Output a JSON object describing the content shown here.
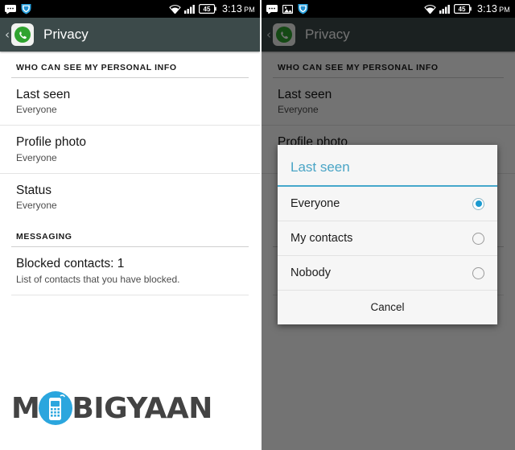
{
  "status_bar": {
    "icons_left": [
      "sms-message-icon",
      "shield-icon"
    ],
    "icons_left_right_panel": [
      "sms-message-icon",
      "image-screenshot-icon",
      "shield-icon"
    ],
    "icons_right": [
      "wifi-icon",
      "signal-bars-icon",
      "battery-icon"
    ],
    "battery_level": "45",
    "time": "3:13",
    "ampm": "PM"
  },
  "action_bar": {
    "app_icon": "whatsapp-icon",
    "back_icon": "back-chevron-icon",
    "title": "Privacy"
  },
  "settings": {
    "sections": [
      {
        "header": "WHO CAN SEE MY PERSONAL INFO",
        "items": [
          {
            "title": "Last seen",
            "subtitle": "Everyone"
          },
          {
            "title": "Profile photo",
            "subtitle": "Everyone"
          },
          {
            "title": "Status",
            "subtitle": "Everyone"
          }
        ]
      },
      {
        "header": "MESSAGING",
        "items": [
          {
            "title": "Blocked contacts: 1",
            "subtitle": "List of contacts that you have blocked."
          }
        ]
      }
    ]
  },
  "dialog": {
    "title": "Last seen",
    "options": [
      {
        "label": "Everyone",
        "selected": true
      },
      {
        "label": "My contacts",
        "selected": false
      },
      {
        "label": "Nobody",
        "selected": false
      }
    ],
    "cancel_label": "Cancel"
  },
  "watermark": {
    "text_before": "M",
    "text_after": "BIGYAAN",
    "icon": "mobile-phone-icon"
  },
  "colors": {
    "action_bar": "#3c4a4a",
    "status_bar": "#000000",
    "dialog_accent": "#46a7cb",
    "radio_selected": "#1a9ad0",
    "scrim": "rgba(0,0,0,0.55)",
    "watermark_blue": "#2ba6de",
    "watermark_gray": "#434343",
    "whatsapp_green": "#2fa32f"
  }
}
